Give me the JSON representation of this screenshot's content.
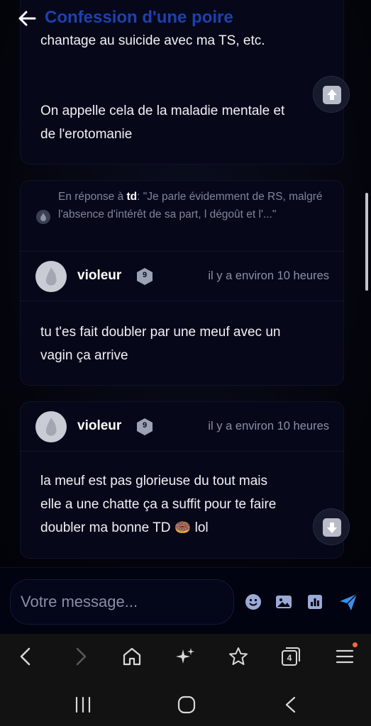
{
  "header": {
    "title": "Confession d'une poire"
  },
  "posts": [
    {
      "body_lines": [
        "chantage au suicide avec ma TS, etc.",
        "",
        "On appelle cela de la maladie mentale et",
        "de l'erotomanie"
      ]
    },
    {
      "reply": {
        "prefix": "En réponse à ",
        "user": "td",
        "quote": ": \"Je parle évidemment de RS, malgré l'absence d'intérêt de sa part, l dégoût et l'...\""
      },
      "author": "violeur",
      "badge": "9",
      "time": "il y a environ 10 heures",
      "body_lines": [
        "tu t'es fait doubler par une meuf avec un",
        "vagin ça arrive"
      ]
    },
    {
      "author": "violeur",
      "badge": "9",
      "time": "il y a environ 10 heures",
      "body_lines": [
        "la meuf est pas glorieuse du tout mais",
        "elle a une chatte ça a suffit pour te faire",
        "doubler ma bonne TD 🍩 lol"
      ]
    }
  ],
  "composer": {
    "placeholder": "Votre message..."
  },
  "browser": {
    "tab_count": "4"
  },
  "colors": {
    "title": "#1e40af",
    "accent_send": "#3b8fe6",
    "notification": "#f26a3a"
  },
  "icons": {
    "fab_up": "arrow-up-icon",
    "fab_down": "arrow-down-icon",
    "composer": [
      "emoji-icon",
      "image-icon",
      "poll-icon",
      "send-icon"
    ],
    "browser": [
      "back-icon",
      "forward-icon",
      "home-icon",
      "sparkle-icon",
      "bookmark-star-icon",
      "tabs-icon",
      "menu-icon"
    ],
    "system": [
      "recent-apps-icon",
      "home-button-icon",
      "back-button-icon"
    ]
  }
}
